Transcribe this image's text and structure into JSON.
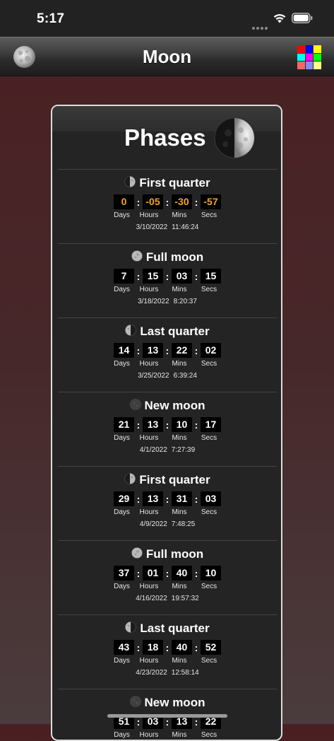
{
  "status_bar": {
    "time": "5:17"
  },
  "nav": {
    "title": "Moon"
  },
  "palette_colors": [
    "#ff0000",
    "#0000ff",
    "#ffff00",
    "#00ffff",
    "#ff00ff",
    "#00ff00",
    "#ff6666",
    "#8888ff",
    "#ffff88"
  ],
  "card": {
    "title": "Phases"
  },
  "labels": {
    "days": "Days",
    "hours": "Hours",
    "mins": "Mins",
    "secs": "Secs"
  },
  "accent_color": "#f5a623",
  "phases": [
    {
      "name": "First quarter",
      "icon": "first-quarter-moon-icon",
      "days": "0",
      "hours": "-05",
      "mins": "-30",
      "secs": "-57",
      "date": "3/10/2022",
      "time": "11:46:24",
      "highlight": true
    },
    {
      "name": "Full moon",
      "icon": "full-moon-icon",
      "days": "7",
      "hours": "15",
      "mins": "03",
      "secs": "15",
      "date": "3/18/2022",
      "time": "8:20:37"
    },
    {
      "name": "Last quarter",
      "icon": "last-quarter-moon-icon",
      "days": "14",
      "hours": "13",
      "mins": "22",
      "secs": "02",
      "date": "3/25/2022",
      "time": "6:39:24"
    },
    {
      "name": "New moon",
      "icon": "new-moon-icon",
      "days": "21",
      "hours": "13",
      "mins": "10",
      "secs": "17",
      "date": "4/1/2022",
      "time": "7:27:39"
    },
    {
      "name": "First quarter",
      "icon": "first-quarter-moon-icon",
      "days": "29",
      "hours": "13",
      "mins": "31",
      "secs": "03",
      "date": "4/9/2022",
      "time": "7:48:25"
    },
    {
      "name": "Full moon",
      "icon": "full-moon-icon",
      "days": "37",
      "hours": "01",
      "mins": "40",
      "secs": "10",
      "date": "4/16/2022",
      "time": "19:57:32"
    },
    {
      "name": "Last quarter",
      "icon": "last-quarter-moon-icon",
      "days": "43",
      "hours": "18",
      "mins": "40",
      "secs": "52",
      "date": "4/23/2022",
      "time": "12:58:14"
    },
    {
      "name": "New moon",
      "icon": "new-moon-icon",
      "days": "51",
      "hours": "03",
      "mins": "13",
      "secs": "22",
      "date": "",
      "time": ""
    }
  ]
}
